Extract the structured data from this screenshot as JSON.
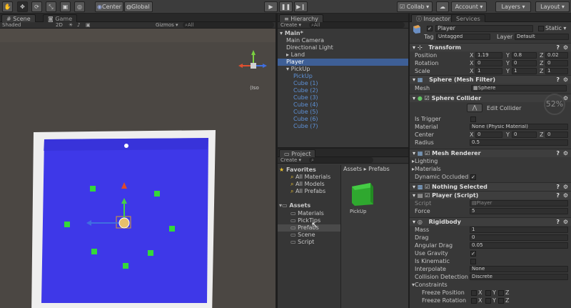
{
  "toolbar": {
    "pivot": "Center",
    "space": "Global",
    "collab": "Collab ▾",
    "account": "Account ▾",
    "layers": "Layers ▾",
    "layout": "Layout ▾"
  },
  "scene": {
    "tabs": [
      "Scene",
      "Game"
    ],
    "shading": "Shaded",
    "mode2d": "2D",
    "gizmos": "Gizmos ▾",
    "search_placeholder": "All",
    "projection": "Iso"
  },
  "hierarchy": {
    "tab": "Hierarchy",
    "create": "Create ▾",
    "search_placeholder": "All",
    "items": [
      {
        "label": "Main*",
        "indent": 0,
        "style": "root"
      },
      {
        "label": "Main Camera",
        "indent": 1,
        "style": "normal"
      },
      {
        "label": "Directional Light",
        "indent": 1,
        "style": "normal"
      },
      {
        "label": "Land",
        "indent": 1,
        "style": "normal"
      },
      {
        "label": "Player",
        "indent": 1,
        "style": "selected"
      },
      {
        "label": "PickUp",
        "indent": 1,
        "style": "normal"
      },
      {
        "label": "PickUp",
        "indent": 2,
        "style": "blue"
      },
      {
        "label": "Cube (1)",
        "indent": 2,
        "style": "blue"
      },
      {
        "label": "Cube (2)",
        "indent": 2,
        "style": "blue"
      },
      {
        "label": "Cube (3)",
        "indent": 2,
        "style": "blue"
      },
      {
        "label": "Cube (4)",
        "indent": 2,
        "style": "blue"
      },
      {
        "label": "Cube (5)",
        "indent": 2,
        "style": "blue"
      },
      {
        "label": "Cube (6)",
        "indent": 2,
        "style": "blue"
      },
      {
        "label": "Cube (7)",
        "indent": 2,
        "style": "blue"
      }
    ]
  },
  "project": {
    "tab": "Project",
    "create": "Create ▾",
    "favorites": "Favorites",
    "fav_items": [
      "All Materials",
      "All Models",
      "All Prefabs"
    ],
    "assets": "Assets",
    "folders": [
      "Materials",
      "PickTips",
      "Prefabs",
      "Scene",
      "Script"
    ],
    "breadcrumb": "Assets ▸ Prefabs",
    "asset_name": "PickUp"
  },
  "inspector": {
    "tabs": [
      "Inspector",
      "Services"
    ],
    "object_name": "Player",
    "static_label": "Static ▾",
    "tag_label": "Tag",
    "tag_value": "Untagged",
    "layer_label": "Layer",
    "layer_value": "Default",
    "transform": {
      "title": "Transform",
      "rows": [
        {
          "label": "Position",
          "x": "1.19",
          "y": "0.8",
          "z": "0.02"
        },
        {
          "label": "Rotation",
          "x": "0",
          "y": "0",
          "z": "0"
        },
        {
          "label": "Scale",
          "x": "1",
          "y": "1",
          "z": "1"
        }
      ]
    },
    "mesh_filter": {
      "title": "Sphere (Mesh Filter)",
      "mesh_label": "Mesh",
      "mesh_value": "Sphere"
    },
    "collider": {
      "title": "Sphere Collider",
      "edit": "Edit Collider",
      "is_trigger": "Is Trigger",
      "material": "Material",
      "material_value": "None (Physic Material)",
      "center": "Center",
      "cx": "0",
      "cy": "0",
      "cz": "0",
      "radius": "Radius",
      "radius_value": "0.5",
      "fps": "52"
    },
    "renderer": {
      "title": "Mesh Renderer",
      "lighting": "Lighting",
      "materials": "Materials",
      "dyn": "Dynamic Occluded"
    },
    "nothing": "Nothing Selected",
    "script": {
      "title": "Player (Script)",
      "script_label": "Script",
      "script_value": "Player",
      "force_label": "Force",
      "force_value": "5"
    },
    "rigidbody": {
      "title": "Rigidbody",
      "mass": "Mass",
      "mass_value": "1",
      "drag": "Drag",
      "drag_value": "0",
      "angular": "Angular Drag",
      "angular_value": "0.05",
      "gravity": "Use Gravity",
      "kinematic": "Is Kinematic",
      "interpolate": "Interpolate",
      "interpolate_value": "None",
      "collision": "Collision Detection",
      "collision_value": "Discrete",
      "constraints": "Constraints",
      "freeze_pos": "Freeze Position",
      "freeze_rot": "Freeze Rotation",
      "axes": [
        "X",
        "Y",
        "Z"
      ]
    }
  },
  "colors": {
    "accent": "#3e5f96",
    "board": "#3e38e8",
    "cube": "#34d83a"
  }
}
